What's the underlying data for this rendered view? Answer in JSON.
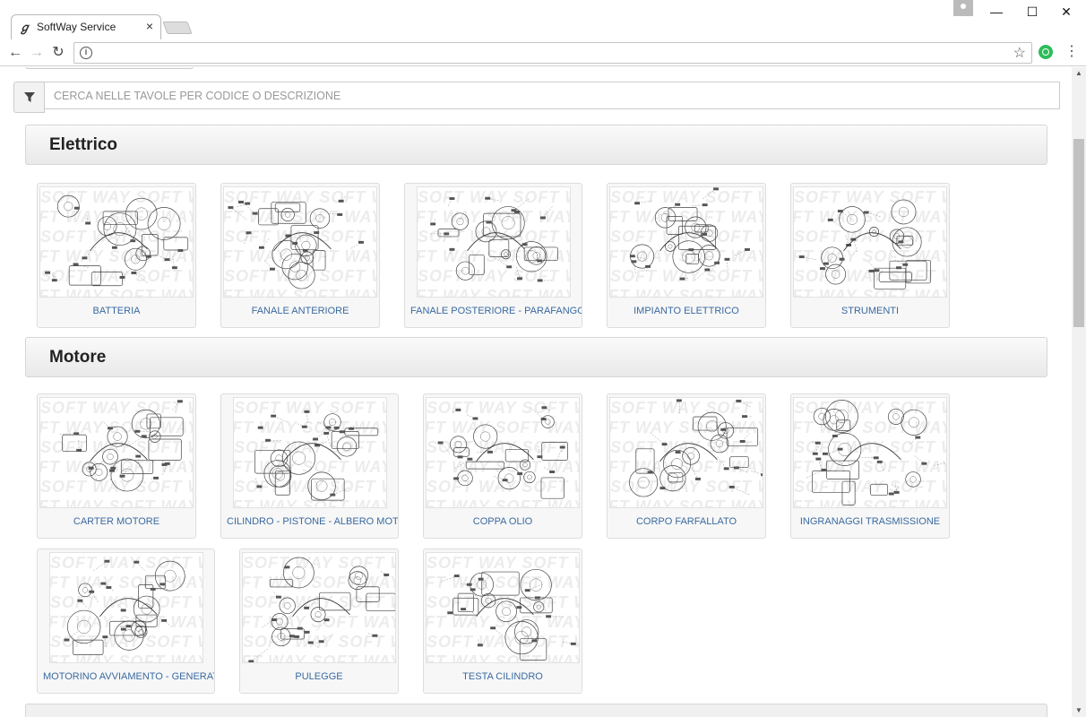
{
  "browser": {
    "tab_title": "SoftWay Service",
    "tab_favicon": "softway-logo",
    "tab_close": "×",
    "window_minimize": "—",
    "window_maximize": "☐",
    "window_close": "✕",
    "back": "←",
    "forward": "→",
    "reload": "↻",
    "info": "i",
    "star": "☆",
    "menu": "⋮"
  },
  "search": {
    "placeholder": "CERCA NELLE TAVOLE PER CODICE O DESCRIZIONE",
    "value": ""
  },
  "sections": [
    {
      "title": "Elettrico",
      "items": [
        {
          "label": "BATTERIA"
        },
        {
          "label": "FANALE ANTERIORE"
        },
        {
          "label": "FANALE POSTERIORE - PARAFANGO"
        },
        {
          "label": "IMPIANTO ELETTRICO"
        },
        {
          "label": "STRUMENTI"
        }
      ]
    },
    {
      "title": "Motore",
      "items": [
        {
          "label": "CARTER MOTORE"
        },
        {
          "label": "CILINDRO - PISTONE - ALBERO MOTORE"
        },
        {
          "label": "COPPA OLIO"
        },
        {
          "label": "CORPO FARFALLATO"
        },
        {
          "label": "INGRANAGGI TRASMISSIONE"
        },
        {
          "label": "MOTORINO AVVIAMENTO - GENERATORE"
        },
        {
          "label": "PULEGGE"
        },
        {
          "label": "TESTA CILINDRO"
        }
      ]
    }
  ],
  "watermark": "SOFT WAY",
  "colors": {
    "link": "#3a6aa0",
    "header_bg": "#efefef",
    "border": "#d6d6d6"
  }
}
